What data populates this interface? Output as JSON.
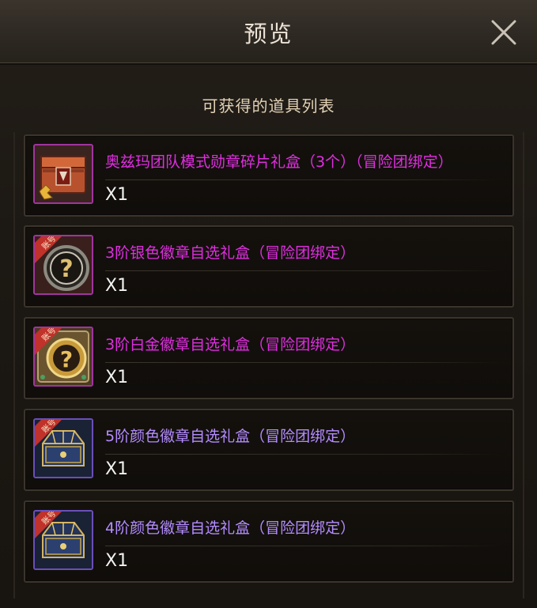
{
  "dialog": {
    "title": "预览",
    "close_icon": "close-icon",
    "subtitle": "可获得的道具列表"
  },
  "colors": {
    "magenta_name": "#e02ee0",
    "violet_name": "#b48cff",
    "account_ribbon": "#c0322a"
  },
  "items": [
    {
      "name": "奥兹玛团队模式勋章碎片礼盒（3个）（冒险团绑定）",
      "qty": "X1",
      "icon": "red-chest-icon"
    },
    {
      "name": "3阶银色徽章自选礼盒（冒险团绑定）",
      "qty": "X1",
      "icon": "silver-badge-select-box-icon",
      "ribbon": "账号"
    },
    {
      "name": "3阶白金徽章自选礼盒（冒险团绑定）",
      "qty": "X1",
      "icon": "platinum-badge-select-box-icon",
      "ribbon": "账号"
    },
    {
      "name": "5阶颜色徽章自选礼盒（冒险团绑定）",
      "qty": "X1",
      "icon": "blue-chest-icon",
      "ribbon": "账号"
    },
    {
      "name": "4阶颜色徽章自选礼盒（冒险团绑定）",
      "qty": "X1",
      "icon": "blue-chest-icon",
      "ribbon": "账号"
    }
  ]
}
